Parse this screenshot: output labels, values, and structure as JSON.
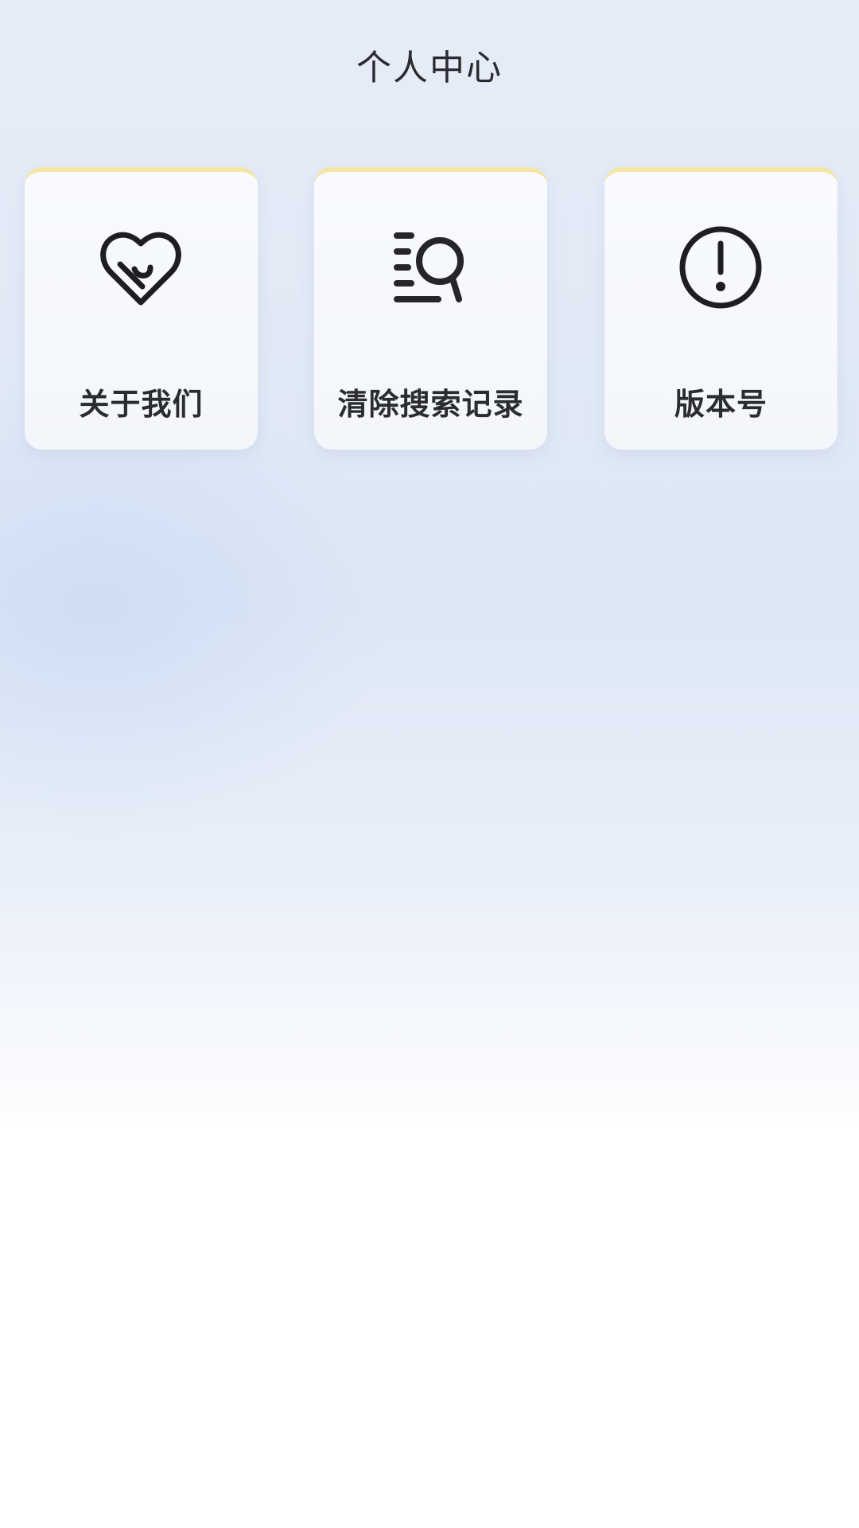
{
  "header": {
    "title": "个人中心"
  },
  "menu": {
    "items": [
      {
        "label": "关于我们",
        "icon": "heart-smile-icon"
      },
      {
        "label": "清除搜索记录",
        "icon": "search-list-icon"
      },
      {
        "label": "版本号",
        "icon": "info-circle-icon"
      }
    ]
  },
  "colors": {
    "card_top_accent": "#f4e6a4",
    "text": "#2b2c31",
    "icon_stroke": "#1e1e22"
  }
}
